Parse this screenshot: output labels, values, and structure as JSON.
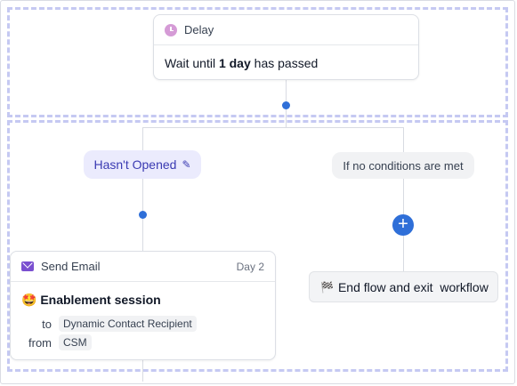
{
  "delay_card": {
    "icon": "clock-icon",
    "title": "Delay",
    "body_prefix": "Wait until ",
    "body_bold": "1 day",
    "body_suffix": " has passed"
  },
  "branches": {
    "left_label": "Hasn't Opened",
    "left_icon": "pencil-icon",
    "right_label": "If no conditions are met"
  },
  "email_card": {
    "icon": "envelope-icon",
    "title": "Send Email",
    "day": "Day 2",
    "subject_emoji": "🤩",
    "subject": "Enablement session",
    "to_label": "to",
    "to_value": "Dynamic Contact Recipient",
    "from_label": "from",
    "from_value": "CSM"
  },
  "end_button": {
    "icon": "checkered-flag-icon",
    "label": "End flow and exit  workflow"
  },
  "add_button": {
    "symbol": "+"
  },
  "colors": {
    "accent_blue": "#2f6fd8",
    "dashed_border": "#c5c9f2",
    "branch_bg": "#ebebfd",
    "branch_text": "#3a3ab2",
    "mail_purple": "#7a4fd0"
  }
}
